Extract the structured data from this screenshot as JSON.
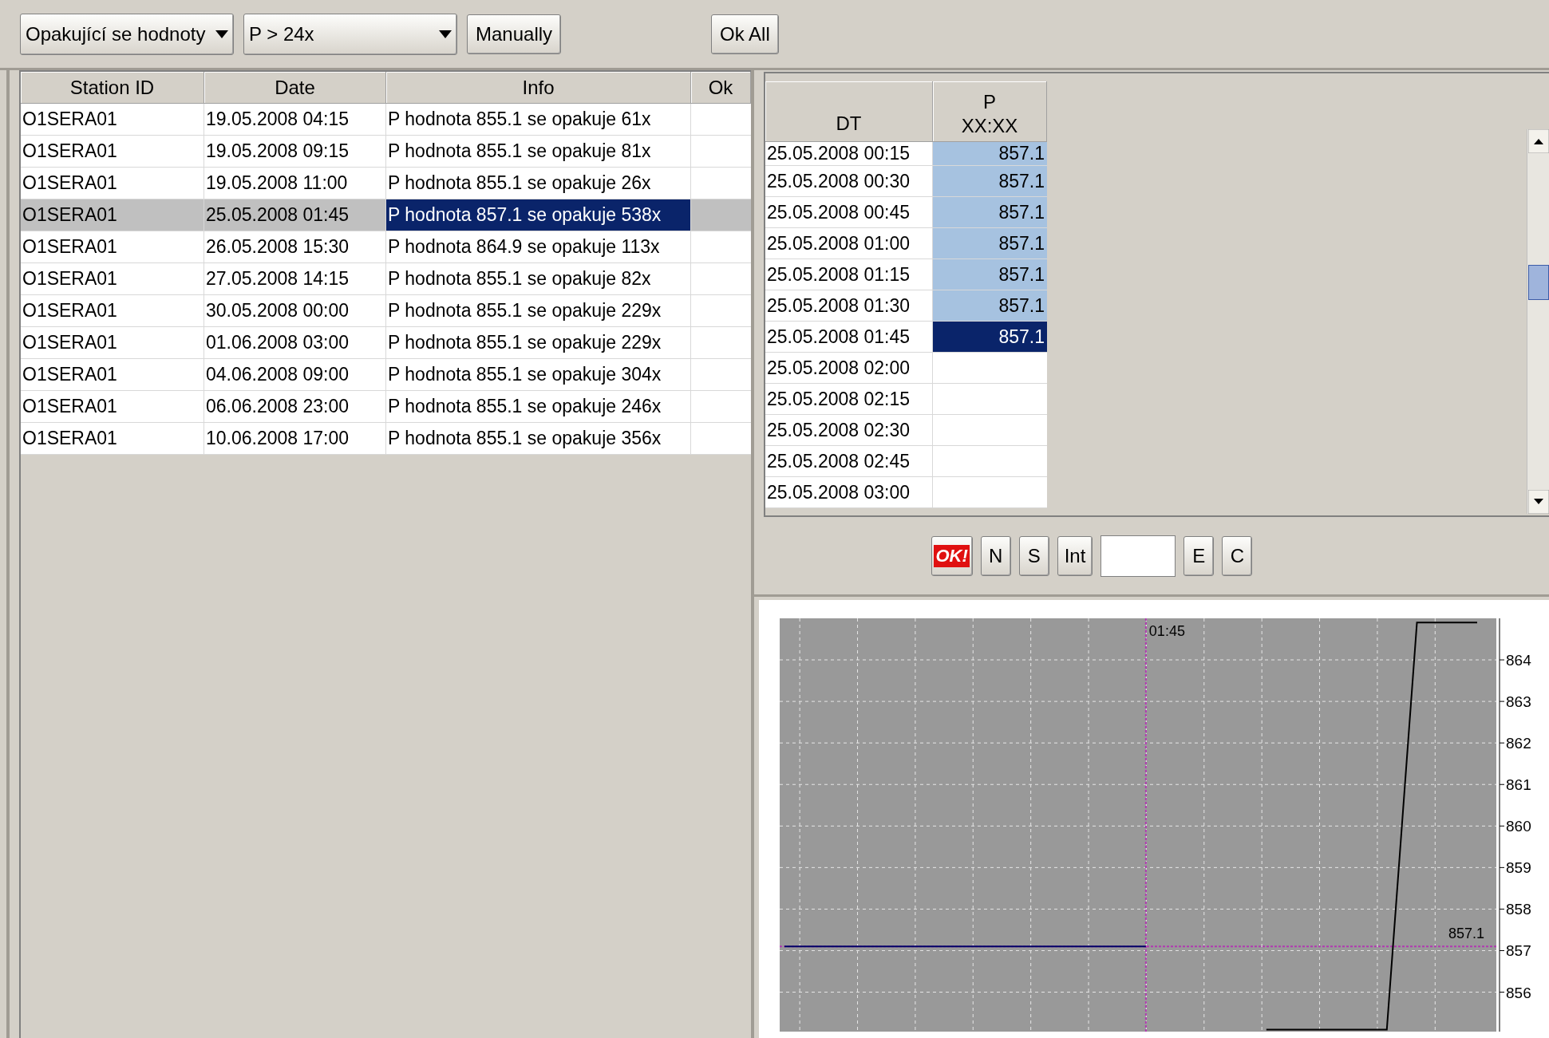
{
  "toolbar": {
    "check_type": {
      "value": "Opakující se hodnoty"
    },
    "threshold": {
      "value": "P > 24x"
    },
    "buttons": [
      "Manually",
      "Ok All"
    ]
  },
  "alerts_table": {
    "columns": [
      "Station ID",
      "Date",
      "Info",
      "Ok"
    ],
    "rows": [
      {
        "station_id": "O1SERA01",
        "date": "19.05.2008 04:15",
        "info": "P hodnota 855.1 se opakuje 61x",
        "selected": false
      },
      {
        "station_id": "O1SERA01",
        "date": "19.05.2008 09:15",
        "info": "P hodnota 855.1 se opakuje 81x",
        "selected": false
      },
      {
        "station_id": "O1SERA01",
        "date": "19.05.2008 11:00",
        "info": "P hodnota 855.1 se opakuje 26x",
        "selected": false
      },
      {
        "station_id": "O1SERA01",
        "date": "25.05.2008 01:45",
        "info": "P hodnota 857.1 se opakuje 538x",
        "selected": true
      },
      {
        "station_id": "O1SERA01",
        "date": "26.05.2008 15:30",
        "info": "P hodnota 864.9 se opakuje 113x",
        "selected": false
      },
      {
        "station_id": "O1SERA01",
        "date": "27.05.2008 14:15",
        "info": "P hodnota 855.1 se opakuje 82x",
        "selected": false
      },
      {
        "station_id": "O1SERA01",
        "date": "30.05.2008 00:00",
        "info": "P hodnota 855.1 se opakuje 229x",
        "selected": false
      },
      {
        "station_id": "O1SERA01",
        "date": "01.06.2008 03:00",
        "info": "P hodnota 855.1 se opakuje 229x",
        "selected": false
      },
      {
        "station_id": "O1SERA01",
        "date": "04.06.2008 09:00",
        "info": "P hodnota 855.1 se opakuje 304x",
        "selected": false
      },
      {
        "station_id": "O1SERA01",
        "date": "06.06.2008 23:00",
        "info": "P hodnota 855.1 se opakuje 246x",
        "selected": false
      },
      {
        "station_id": "O1SERA01",
        "date": "10.06.2008 17:00",
        "info": "P hodnota 855.1 se opakuje 356x",
        "selected": false
      }
    ]
  },
  "values_table": {
    "columns": [
      {
        "label": "DT"
      },
      {
        "label": "P",
        "sublabel": "XX:XX"
      }
    ],
    "rows": [
      {
        "dt": "25.05.2008 00:15",
        "p": "857.1",
        "highlighted": true,
        "selected": false
      },
      {
        "dt": "25.05.2008 00:30",
        "p": "857.1",
        "highlighted": true,
        "selected": false
      },
      {
        "dt": "25.05.2008 00:45",
        "p": "857.1",
        "highlighted": true,
        "selected": false
      },
      {
        "dt": "25.05.2008 01:00",
        "p": "857.1",
        "highlighted": true,
        "selected": false
      },
      {
        "dt": "25.05.2008 01:15",
        "p": "857.1",
        "highlighted": true,
        "selected": false
      },
      {
        "dt": "25.05.2008 01:30",
        "p": "857.1",
        "highlighted": true,
        "selected": false
      },
      {
        "dt": "25.05.2008 01:45",
        "p": "857.1",
        "highlighted": true,
        "selected": true
      },
      {
        "dt": "25.05.2008 02:00",
        "highlighted": false,
        "selected": false
      },
      {
        "dt": "25.05.2008 02:15",
        "highlighted": false,
        "selected": false
      },
      {
        "dt": "25.05.2008 02:30",
        "highlighted": false,
        "selected": false
      },
      {
        "dt": "25.05.2008 02:45",
        "highlighted": false,
        "selected": false
      },
      {
        "dt": "25.05.2008 03:00",
        "highlighted": false,
        "selected": false
      }
    ]
  },
  "edit_bar": [
    {
      "kind": "alert",
      "label": "OK!"
    },
    {
      "kind": "button",
      "label": "N"
    },
    {
      "kind": "button",
      "label": "S"
    },
    {
      "kind": "button",
      "label": "Int"
    },
    {
      "kind": "field"
    },
    {
      "kind": "button",
      "label": "E"
    },
    {
      "kind": "button",
      "label": "C"
    }
  ],
  "chart": {
    "cursor": {
      "time": "01:45",
      "value": "857.1"
    },
    "chart_data": {
      "type": "line",
      "grid": true,
      "ref_lines": [
        {
          "axis": "y",
          "value": 857.1
        }
      ],
      "ylim": [
        855.05,
        865.0
      ],
      "yticks": [
        856,
        857,
        858,
        859,
        860,
        861,
        862,
        863,
        864
      ],
      "categories": [
        null,
        null,
        null,
        null,
        null,
        null,
        null,
        null,
        null,
        null,
        null,
        null,
        null,
        null,
        null,
        null,
        null,
        null,
        null,
        null,
        null,
        null,
        null,
        null
      ],
      "series": [
        {
          "color": "#000066",
          "values": [
            857.1,
            857.1,
            857.1,
            857.1,
            857.1,
            857.1,
            857.1,
            857.1,
            857.1,
            857.1,
            857.1,
            857.1,
            857.1,
            null,
            null,
            null,
            null,
            null,
            null,
            null,
            null,
            null,
            null,
            null
          ]
        },
        {
          "color": "#000000",
          "values": [
            null,
            null,
            null,
            null,
            null,
            null,
            null,
            null,
            null,
            null,
            null,
            null,
            null,
            null,
            null,
            null,
            855.1,
            855.1,
            855.1,
            855.1,
            855.1,
            864.9,
            864.9,
            864.9
          ]
        }
      ]
    }
  }
}
